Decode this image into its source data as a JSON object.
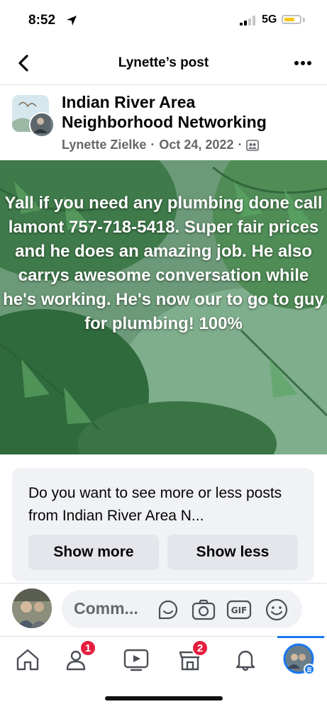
{
  "status_bar": {
    "time": "8:52",
    "network": "5G",
    "battery_color": "#f5c518"
  },
  "nav": {
    "title": "Lynette’s post",
    "back_icon": "chevron-left-icon",
    "more_icon": "ellipsis-icon"
  },
  "post": {
    "group_name": "Indian River Area Neighborhood Networking",
    "author": "Lynette Zielke",
    "separator": "·",
    "date": "Oct 24, 2022",
    "privacy_icon": "members-icon",
    "text": "Yall if you need any plumbing done call lamont 757-718-5418. Super fair prices and he does an amazing job. He also carrys awesome conversation while he's working.  He's now our to go to guy for plumbing! 100%"
  },
  "feedback": {
    "question": "Do you want to see more or less posts from Indian River Area N...",
    "show_more_label": "Show more",
    "show_less_label": "Show less"
  },
  "comment_bar": {
    "placeholder": "Comm...",
    "icons": [
      "sticker-icon",
      "camera-icon",
      "gif-icon",
      "emoji-icon"
    ]
  },
  "tab_bar": {
    "tabs": [
      {
        "icon": "home-icon"
      },
      {
        "icon": "friends-icon",
        "badge": "1"
      },
      {
        "icon": "video-icon"
      },
      {
        "icon": "marketplace-icon",
        "badge": "2"
      },
      {
        "icon": "bell-icon"
      },
      {
        "icon": "profile-menu-icon",
        "active": true
      }
    ],
    "accent_color": "#1877f2",
    "badge_color": "#e41e3f"
  }
}
